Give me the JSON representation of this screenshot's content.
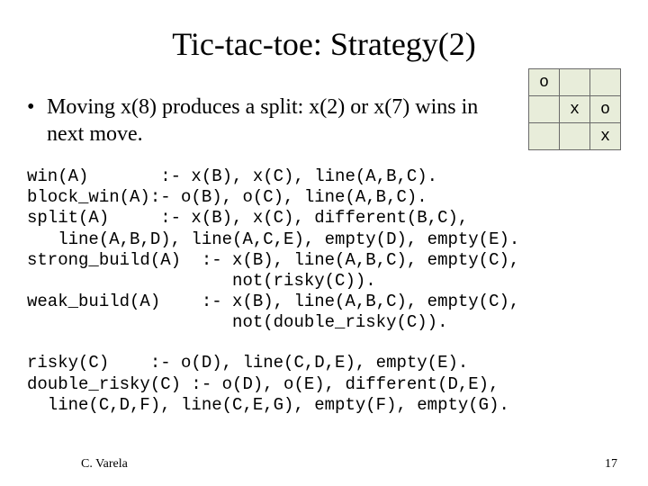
{
  "title": "Tic-tac-toe:  Strategy(2)",
  "bullet": {
    "marker": "•",
    "text": "Moving x(8) produces a split: x(2) or x(7) wins in next move."
  },
  "board": {
    "r0c0": "o",
    "r0c1": "",
    "r0c2": "",
    "r1c0": "",
    "r1c1": "x",
    "r1c2": "o",
    "r2c0": "",
    "r2c1": "",
    "r2c2": "x"
  },
  "code_block_1": "win(A)       :- x(B), x(C), line(A,B,C).\nblock_win(A):- o(B), o(C), line(A,B,C).\nsplit(A)     :- x(B), x(C), different(B,C),\n   line(A,B,D), line(A,C,E), empty(D), empty(E).\nstrong_build(A)  :- x(B), line(A,B,C), empty(C),\n                    not(risky(C)).\nweak_build(A)    :- x(B), line(A,B,C), empty(C),\n                    not(double_risky(C)).",
  "code_block_2": "risky(C)    :- o(D), line(C,D,E), empty(E).\ndouble_risky(C) :- o(D), o(E), different(D,E),\n  line(C,D,F), line(C,E,G), empty(F), empty(G).",
  "footer": {
    "author": "C. Varela",
    "page": "17"
  }
}
